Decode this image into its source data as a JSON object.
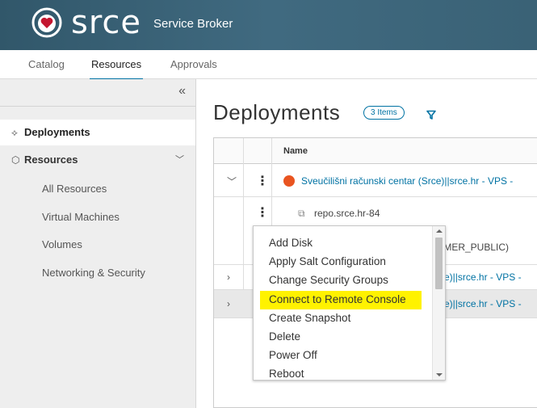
{
  "header": {
    "brand": "srce",
    "app_name": "Service Broker"
  },
  "tabs": [
    {
      "label": "Catalog"
    },
    {
      "label": "Resources",
      "active": true
    },
    {
      "label": "Approvals"
    }
  ],
  "sidebar": {
    "collapse_glyph": "«",
    "deployments": "Deployments",
    "resources": "Resources",
    "sub_items": [
      {
        "label": "All Resources"
      },
      {
        "label": "Virtual Machines"
      },
      {
        "label": "Volumes"
      },
      {
        "label": "Networking & Security"
      }
    ]
  },
  "main": {
    "title": "Deployments",
    "count_badge": "3 Items",
    "column_name": "Name",
    "rows": [
      {
        "name": "Sveučilišni računski centar (Srce)||srce.hr - VPS -",
        "expanded": true
      },
      {
        "name": "repo.srce.hr-84",
        "icon": "vm-icon"
      },
      {
        "name": "OMER_PUBLIC)"
      },
      {
        "name": "rce)||srce.hr - VPS -"
      },
      {
        "name": "rce)||srce.hr - VPS -"
      }
    ]
  },
  "menu": {
    "items": [
      {
        "label": "Add Disk"
      },
      {
        "label": "Apply Salt Configuration"
      },
      {
        "label": "Change Security Groups"
      },
      {
        "label": "Connect to Remote Console",
        "highlighted": true
      },
      {
        "label": "Create Snapshot"
      },
      {
        "label": "Delete"
      },
      {
        "label": "Power Off"
      },
      {
        "label": "Reboot"
      }
    ]
  },
  "colors": {
    "header_bg": "#3a6276",
    "accent": "#0072a3",
    "highlight": "#fff200",
    "ubuntu": "#e95420"
  }
}
